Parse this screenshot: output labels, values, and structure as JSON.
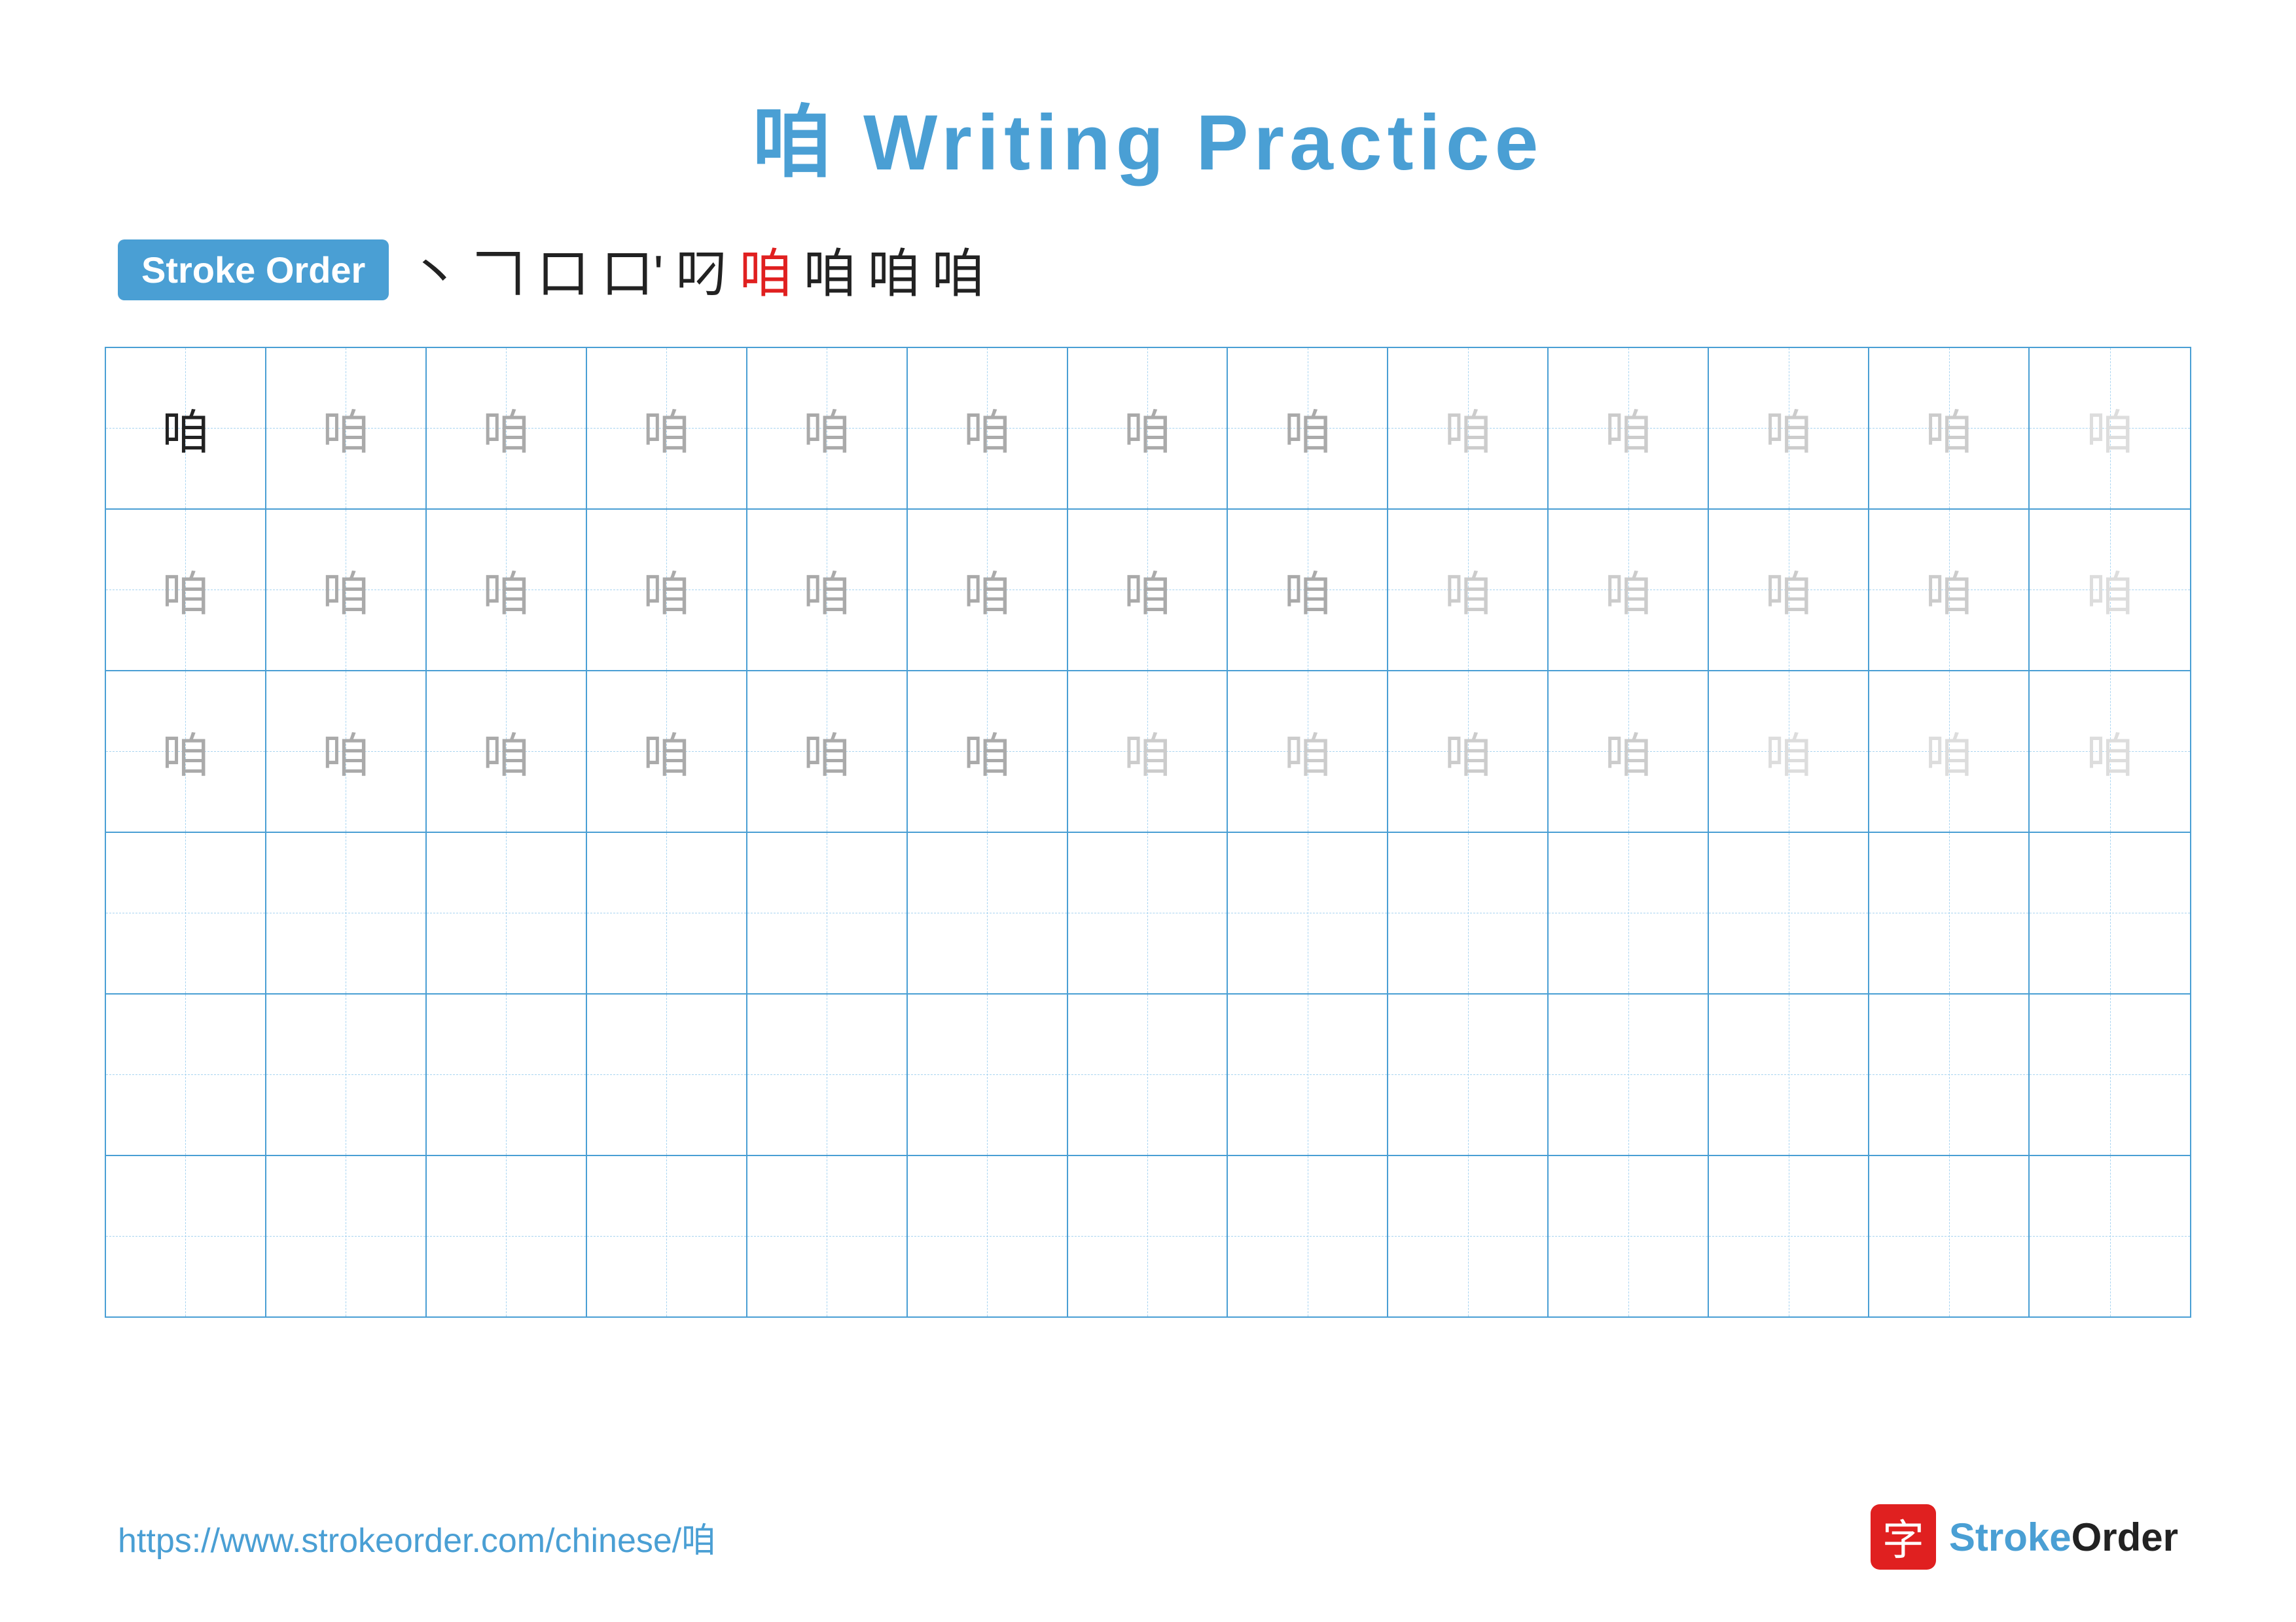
{
  "title": "咱 Writing Practice",
  "stroke_order": {
    "badge_label": "Stroke Order",
    "sequence": [
      "丶",
      "𠃍",
      "口",
      "口'",
      "叼",
      "咱",
      "咱",
      "咱",
      "咱"
    ]
  },
  "character": "咱",
  "grid": {
    "rows": 6,
    "cols": 13,
    "row_data": [
      {
        "cells": [
          {
            "char": "咱",
            "style": "dark"
          },
          {
            "char": "咱",
            "style": "medium-gray"
          },
          {
            "char": "咱",
            "style": "medium-gray"
          },
          {
            "char": "咱",
            "style": "medium-gray"
          },
          {
            "char": "咱",
            "style": "medium-gray"
          },
          {
            "char": "咱",
            "style": "medium-gray"
          },
          {
            "char": "咱",
            "style": "medium-gray"
          },
          {
            "char": "咱",
            "style": "medium-gray"
          },
          {
            "char": "咱",
            "style": "light-gray"
          },
          {
            "char": "咱",
            "style": "light-gray"
          },
          {
            "char": "咱",
            "style": "light-gray"
          },
          {
            "char": "咱",
            "style": "light-gray"
          },
          {
            "char": "咱",
            "style": "very-light"
          }
        ]
      },
      {
        "cells": [
          {
            "char": "咱",
            "style": "medium-gray"
          },
          {
            "char": "咱",
            "style": "medium-gray"
          },
          {
            "char": "咱",
            "style": "medium-gray"
          },
          {
            "char": "咱",
            "style": "medium-gray"
          },
          {
            "char": "咱",
            "style": "medium-gray"
          },
          {
            "char": "咱",
            "style": "medium-gray"
          },
          {
            "char": "咱",
            "style": "medium-gray"
          },
          {
            "char": "咱",
            "style": "medium-gray"
          },
          {
            "char": "咱",
            "style": "light-gray"
          },
          {
            "char": "咱",
            "style": "light-gray"
          },
          {
            "char": "咱",
            "style": "light-gray"
          },
          {
            "char": "咱",
            "style": "light-gray"
          },
          {
            "char": "咱",
            "style": "very-light"
          }
        ]
      },
      {
        "cells": [
          {
            "char": "咱",
            "style": "medium-gray"
          },
          {
            "char": "咱",
            "style": "medium-gray"
          },
          {
            "char": "咱",
            "style": "medium-gray"
          },
          {
            "char": "咱",
            "style": "medium-gray"
          },
          {
            "char": "咱",
            "style": "medium-gray"
          },
          {
            "char": "咱",
            "style": "medium-gray"
          },
          {
            "char": "咱",
            "style": "light-gray"
          },
          {
            "char": "咱",
            "style": "light-gray"
          },
          {
            "char": "咱",
            "style": "light-gray"
          },
          {
            "char": "咱",
            "style": "light-gray"
          },
          {
            "char": "咱",
            "style": "very-light"
          },
          {
            "char": "咱",
            "style": "very-light"
          },
          {
            "char": "咱",
            "style": "very-light"
          }
        ]
      },
      {
        "cells": [
          {
            "char": "",
            "style": ""
          },
          {
            "char": "",
            "style": ""
          },
          {
            "char": "",
            "style": ""
          },
          {
            "char": "",
            "style": ""
          },
          {
            "char": "",
            "style": ""
          },
          {
            "char": "",
            "style": ""
          },
          {
            "char": "",
            "style": ""
          },
          {
            "char": "",
            "style": ""
          },
          {
            "char": "",
            "style": ""
          },
          {
            "char": "",
            "style": ""
          },
          {
            "char": "",
            "style": ""
          },
          {
            "char": "",
            "style": ""
          },
          {
            "char": "",
            "style": ""
          }
        ]
      },
      {
        "cells": [
          {
            "char": "",
            "style": ""
          },
          {
            "char": "",
            "style": ""
          },
          {
            "char": "",
            "style": ""
          },
          {
            "char": "",
            "style": ""
          },
          {
            "char": "",
            "style": ""
          },
          {
            "char": "",
            "style": ""
          },
          {
            "char": "",
            "style": ""
          },
          {
            "char": "",
            "style": ""
          },
          {
            "char": "",
            "style": ""
          },
          {
            "char": "",
            "style": ""
          },
          {
            "char": "",
            "style": ""
          },
          {
            "char": "",
            "style": ""
          },
          {
            "char": "",
            "style": ""
          }
        ]
      },
      {
        "cells": [
          {
            "char": "",
            "style": ""
          },
          {
            "char": "",
            "style": ""
          },
          {
            "char": "",
            "style": ""
          },
          {
            "char": "",
            "style": ""
          },
          {
            "char": "",
            "style": ""
          },
          {
            "char": "",
            "style": ""
          },
          {
            "char": "",
            "style": ""
          },
          {
            "char": "",
            "style": ""
          },
          {
            "char": "",
            "style": ""
          },
          {
            "char": "",
            "style": ""
          },
          {
            "char": "",
            "style": ""
          },
          {
            "char": "",
            "style": ""
          },
          {
            "char": "",
            "style": ""
          }
        ]
      }
    ]
  },
  "footer": {
    "url": "https://www.strokeorder.com/chinese/咱",
    "logo_text": "StrokeOrder",
    "logo_prefix": "字"
  }
}
